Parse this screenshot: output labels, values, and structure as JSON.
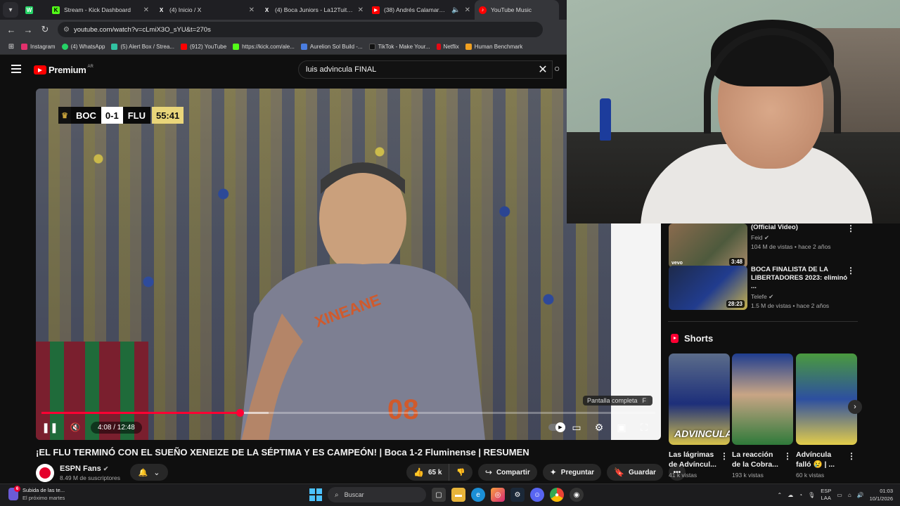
{
  "tabs": [
    {
      "label": "",
      "color": "#25d366",
      "glyph": "W"
    },
    {
      "label": "Stream - Kick Dashboard",
      "color": "#53fc18",
      "glyph": "K"
    },
    {
      "label": "(4) Inicio / X",
      "color": "#000000",
      "glyph": "X"
    },
    {
      "label": "(4) Boca Juniors - La12Tuitter",
      "color": "#000000",
      "glyph": "X"
    },
    {
      "label": "(38) Andrés Calamaro - Cl",
      "color": "#ff0000",
      "glyph": "▶"
    },
    {
      "label": "YouTube Music",
      "color": "#ff0000",
      "glyph": "♪"
    }
  ],
  "address": {
    "url": "youtube.com/watch?v=cLmiX3O_sYU&t=270s"
  },
  "bookmarks": [
    {
      "label": "Instagram",
      "color": "#e1306c"
    },
    {
      "label": "(4) WhatsApp",
      "color": "#25d366"
    },
    {
      "label": "(5) Alert Box / Strea...",
      "color": "#31c3a2"
    },
    {
      "label": "(912) YouTube",
      "color": "#ff0000"
    },
    {
      "label": "https://kick.com/ale...",
      "color": "#53fc18"
    },
    {
      "label": "Aurelion Sol Build -...",
      "color": "#4a7de0"
    },
    {
      "label": "TikTok - Make Your...",
      "color": "#111111"
    },
    {
      "label": "Netflix",
      "color": "#e50914"
    },
    {
      "label": "Human Benchmark",
      "color": "#f0a020"
    }
  ],
  "youtube": {
    "logo_text": "Premium",
    "region": "AR",
    "search_value": "luis advincula FINAL"
  },
  "video": {
    "scorebug": {
      "home": "BOC",
      "score": "0-1",
      "away": "FLU",
      "clock": "55:41"
    },
    "time": "4:08 / 12:48",
    "progress_played": 0.323,
    "progress_buffered": 0.37,
    "tooltip": "Pantalla completa",
    "tooltip_key": "F",
    "title": "¡EL FLU TERMINÓ CON EL SUEÑO XENEIZE DE LA SÉPTIMA Y ES CAMPEÓN! | Boca 1-2 Fluminense | RESUMEN"
  },
  "channel": {
    "name": "ESPN Fans",
    "subscribers": "8.49 M de suscriptores"
  },
  "actions": {
    "likes": "65 k",
    "share": "Compartir",
    "ask": "Preguntar",
    "save": "Guardar"
  },
  "recommendations": [
    {
      "title": "(Official Video)",
      "channel": "Feid",
      "stats": "104 M de vistas • hace 2 años",
      "duration": "3:48",
      "badge": "vevo"
    },
    {
      "title": "BOCA FINALISTA DE LA LIBERTADORES 2023: eliminó ...",
      "channel": "Telefe",
      "stats": "1.5 M de vistas • hace 2 años",
      "duration": "28:23",
      "badge": ""
    }
  ],
  "shorts": {
    "heading": "Shorts",
    "items": [
      {
        "title": "Las lágrimas de Advíncul...",
        "views": "41 k vistas",
        "overlay": "ADVINCULA"
      },
      {
        "title": "La reacción de la Cobra...",
        "views": "193 k vistas",
        "overlay": ""
      },
      {
        "title": "Advíncula falló 😢 | ...",
        "views": "60 k vistas",
        "overlay": ""
      }
    ]
  },
  "taskbar": {
    "weather_title": "Subida de las te...",
    "weather_sub": "El próximo martes",
    "weather_badge": "6",
    "search_placeholder": "Buscar",
    "lang_line1": "ESP",
    "lang_line2": "LAA",
    "time": "01:03",
    "date": "10/1/2026"
  }
}
